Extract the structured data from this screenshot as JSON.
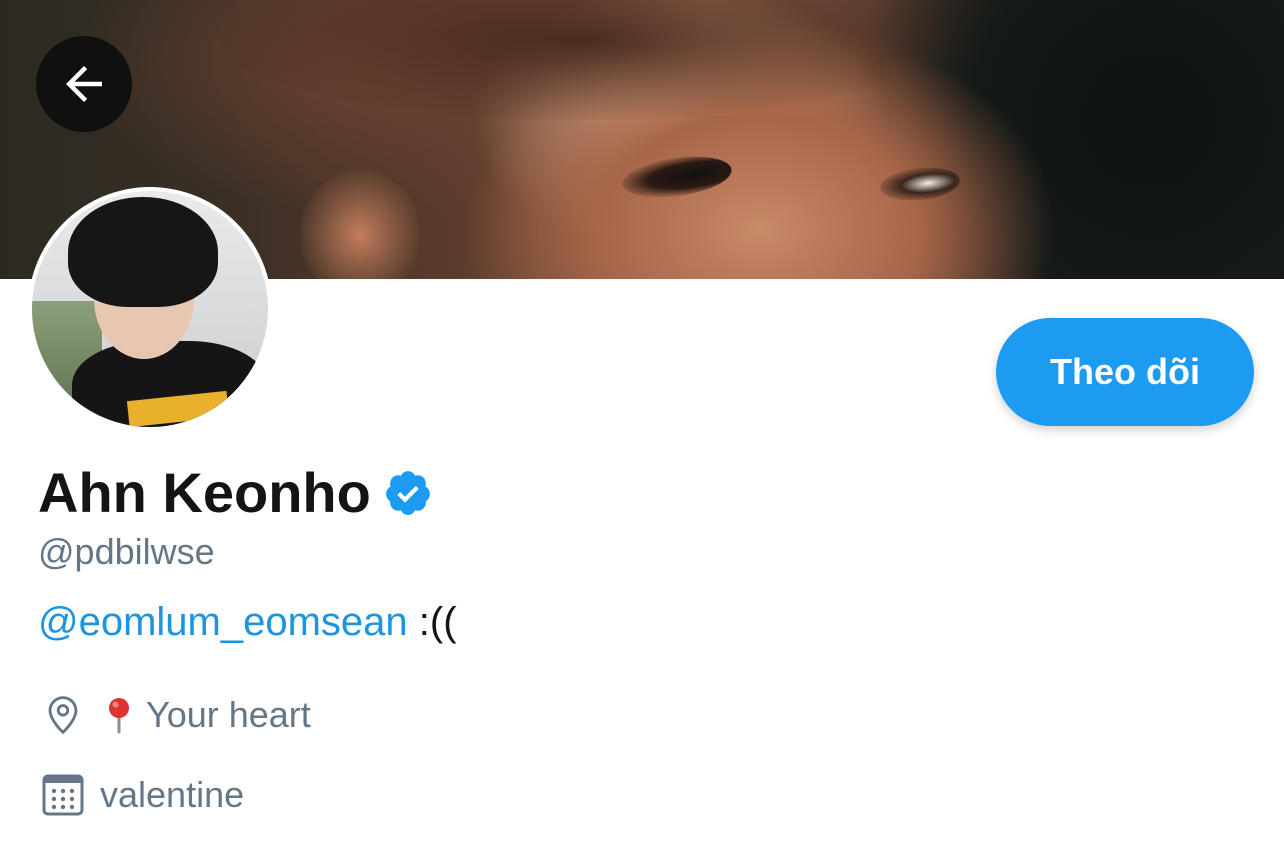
{
  "header": {
    "back_icon": "arrow-left-icon"
  },
  "profile": {
    "display_name": "Ahn Keonho",
    "verified_icon": "verified-badge-icon",
    "handle": "@pdbilwse",
    "follow_label": "Theo dõi",
    "bio": {
      "mention": "@eomlum_eomsean",
      "text": " :(("
    },
    "location": {
      "icon": "location-pin-icon",
      "emoji": "round-pushpin-emoji",
      "text": "Your heart"
    },
    "birthday": {
      "icon": "calendar-icon",
      "text": "valentine"
    }
  },
  "colors": {
    "accent": "#1d9bf0",
    "link": "#1b95e0",
    "secondary_text": "#657786",
    "primary_text": "#141414"
  }
}
